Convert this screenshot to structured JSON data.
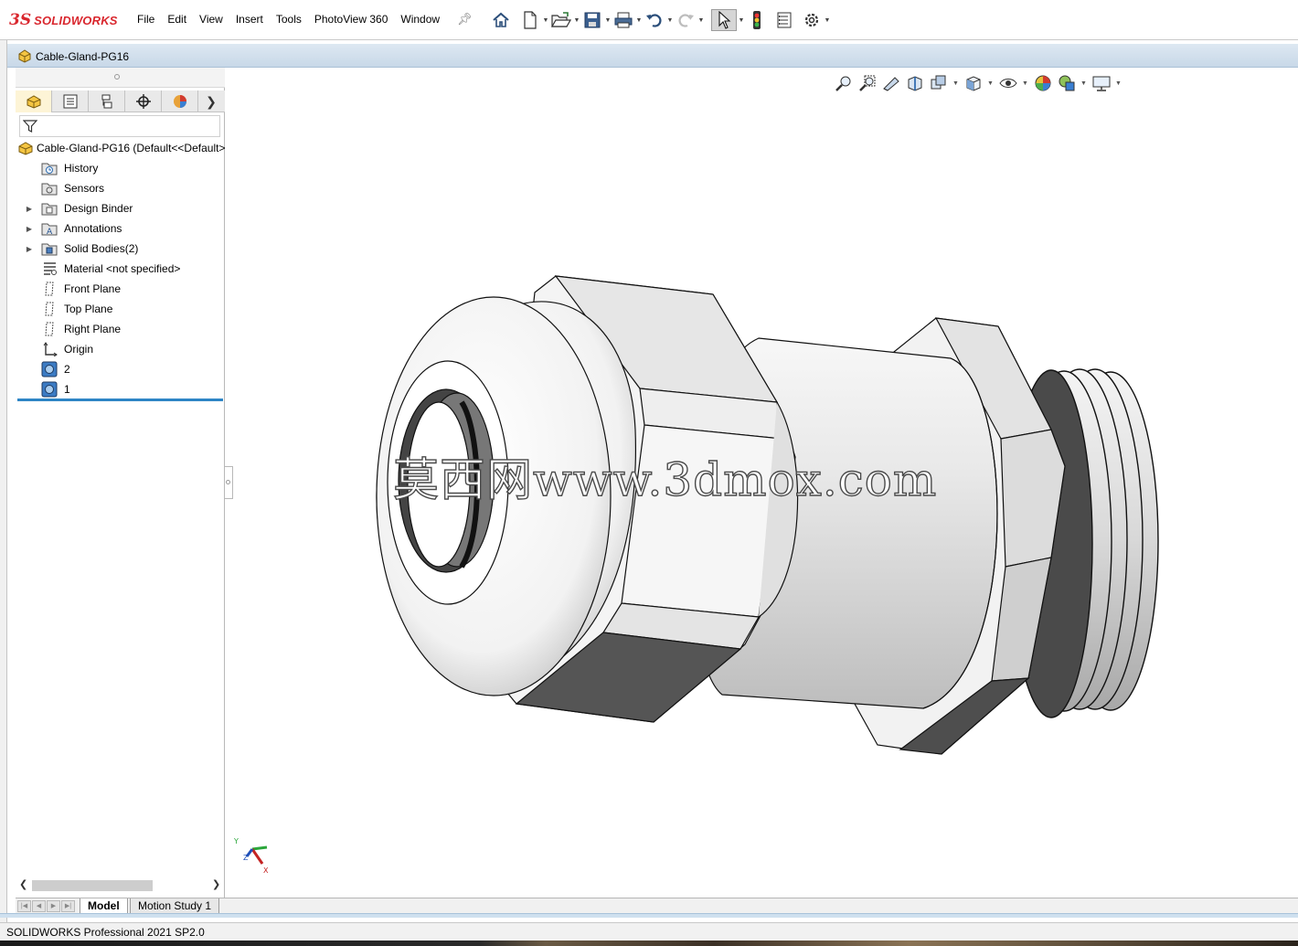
{
  "app": {
    "logo_ds": "3S",
    "logo_text": "SOLIDWORKS"
  },
  "menu": [
    "File",
    "Edit",
    "View",
    "Insert",
    "Tools",
    "PhotoView 360",
    "Window"
  ],
  "document": {
    "title": "Cable-Gland-PG16"
  },
  "feature_tree": {
    "root": "Cable-Gland-PG16  (Default<<Default>",
    "items": [
      {
        "label": "History",
        "icon": "history-folder-icon"
      },
      {
        "label": "Sensors",
        "icon": "sensors-folder-icon"
      },
      {
        "label": "Design Binder",
        "icon": "design-binder-icon",
        "expandable": true
      },
      {
        "label": "Annotations",
        "icon": "annotations-icon",
        "expandable": true
      },
      {
        "label": "Solid Bodies(2)",
        "icon": "solid-bodies-icon",
        "expandable": true
      },
      {
        "label": "Material <not specified>",
        "icon": "material-icon"
      },
      {
        "label": "Front Plane",
        "icon": "plane-icon"
      },
      {
        "label": "Top Plane",
        "icon": "plane-icon"
      },
      {
        "label": "Right Plane",
        "icon": "plane-icon"
      },
      {
        "label": "Origin",
        "icon": "origin-icon"
      },
      {
        "label": "2",
        "icon": "imported-body-icon"
      },
      {
        "label": "1",
        "icon": "imported-body-icon"
      }
    ]
  },
  "bottom_tabs": {
    "model": "Model",
    "motion": "Motion Study 1"
  },
  "status": {
    "text": "SOLIDWORKS Professional 2021 SP2.0"
  },
  "viewport": {
    "watermark": "莫西网www.3dmox.com",
    "triad": {
      "x": "X",
      "y": "Y",
      "z": "Z"
    }
  },
  "colors": {
    "brand": "#d9272e",
    "accent": "#2e85c5",
    "doc_bar": "#dde8f2"
  }
}
